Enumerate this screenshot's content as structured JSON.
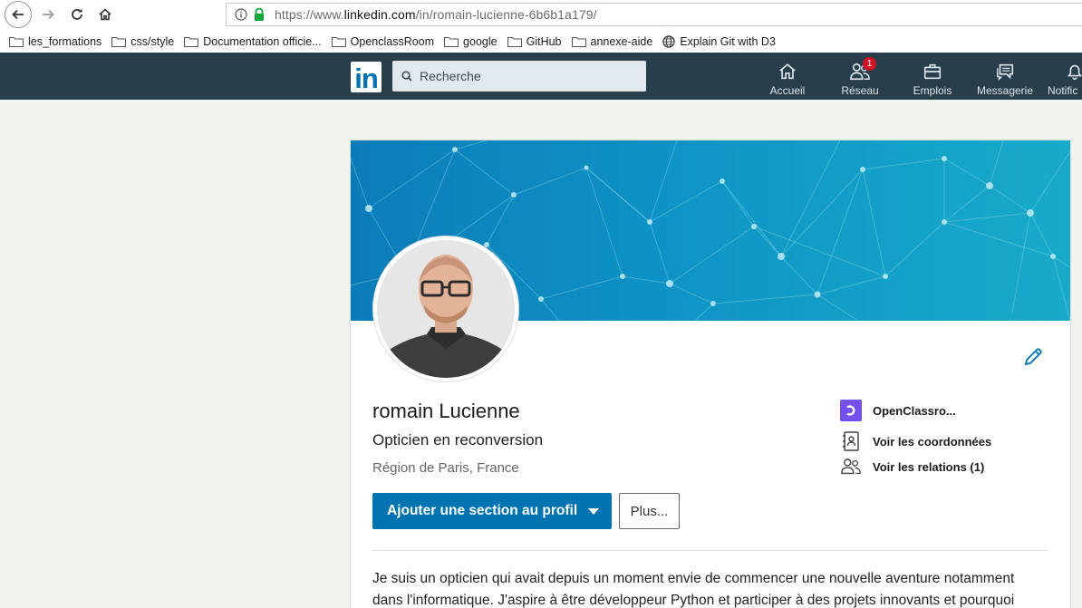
{
  "browser": {
    "url_prefix": "https://www.",
    "url_host": "linkedin.com",
    "url_path": "/in/romain-lucienne-6b6b1a179/",
    "bookmarks": [
      {
        "label": "les_formations",
        "icon": "folder-icon"
      },
      {
        "label": "css/style",
        "icon": "folder-icon"
      },
      {
        "label": "Documentation officie...",
        "icon": "folder-icon"
      },
      {
        "label": "OpenclassRoom",
        "icon": "folder-icon"
      },
      {
        "label": "google",
        "icon": "folder-icon"
      },
      {
        "label": "GitHub",
        "icon": "folder-icon"
      },
      {
        "label": "annexe-aide",
        "icon": "folder-icon"
      },
      {
        "label": "Explain Git with D3",
        "icon": "globe-icon"
      }
    ]
  },
  "linkedin_nav": {
    "logo": "in",
    "search_placeholder": "Recherche",
    "items": [
      {
        "label": "Accueil",
        "icon": "home-icon"
      },
      {
        "label": "Réseau",
        "icon": "network-icon",
        "badge": "1"
      },
      {
        "label": "Emplois",
        "icon": "briefcase-icon"
      },
      {
        "label": "Messagerie",
        "icon": "messages-icon"
      },
      {
        "label": "Notific",
        "icon": "bell-icon"
      }
    ],
    "colors": {
      "bar": "#283e4a",
      "brand": "#0073b1",
      "badge": "#d11124"
    }
  },
  "profile": {
    "name": "romain Lucienne",
    "headline": "Opticien en reconversion",
    "location": "Région de Paris, France",
    "primary_button": "Ajouter une section au profil",
    "more_button": "Plus...",
    "side_links": [
      {
        "label": "OpenClassro...",
        "icon": "openclassrooms-logo-icon"
      },
      {
        "label": "Voir les coordonnées",
        "icon": "contact-card-icon"
      },
      {
        "label": "Voir les relations (1)",
        "icon": "people-icon"
      }
    ],
    "summary": "Je suis un opticien qui avait depuis un moment envie de commencer une nouvelle aventure notamment dans l'informatique. J'aspire à être développeur Python et participer à des projets innovants et pourquoi"
  }
}
